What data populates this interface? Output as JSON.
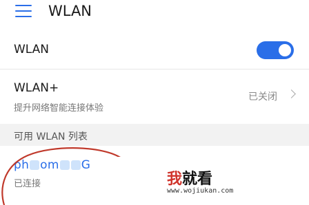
{
  "header": {
    "title": "WLAN",
    "menu_icon": "hamburger-menu-icon"
  },
  "wlan_row": {
    "label": "WLAN",
    "toggle_on": true
  },
  "wlan_plus_row": {
    "label": "WLAN+",
    "subtitle": "提升网络智能连接体验",
    "status": "已关闭"
  },
  "section": {
    "title": "可用 WLAN 列表"
  },
  "network": {
    "name_start": "ph",
    "name_mid": "om",
    "name_end": "G",
    "status": "已连接"
  },
  "watermark": {
    "accent": "我",
    "rest": "就看",
    "url": "www.wojiukan.com"
  },
  "colors": {
    "accent": "#2a6ee8",
    "annotation": "#c0392b"
  }
}
